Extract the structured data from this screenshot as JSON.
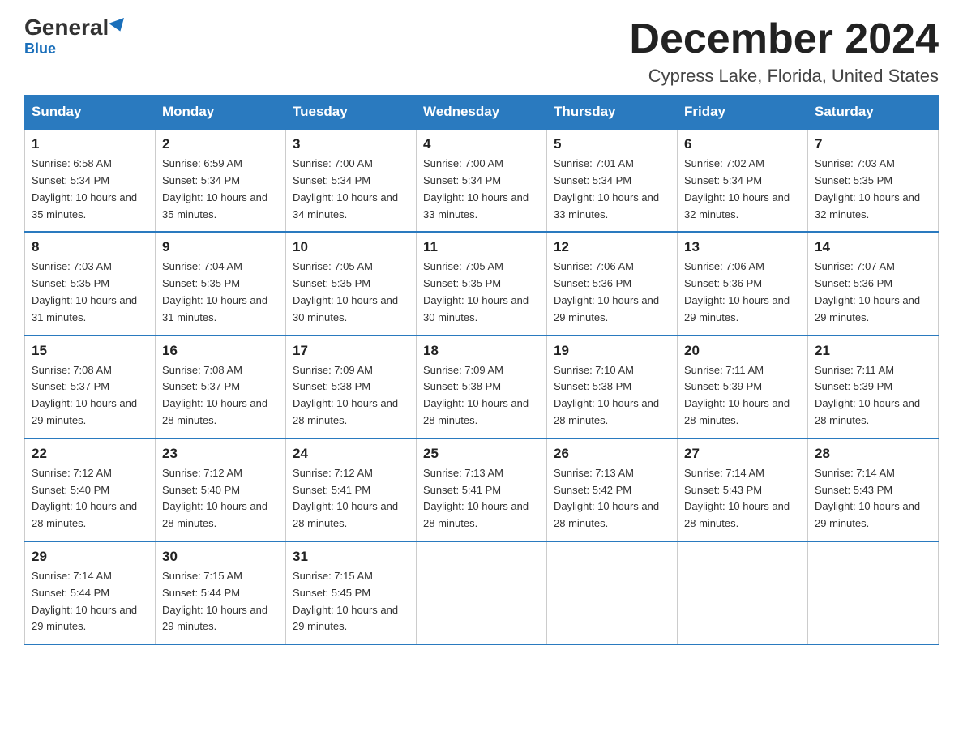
{
  "logo": {
    "name": "General",
    "name2": "Blue"
  },
  "header": {
    "month": "December 2024",
    "location": "Cypress Lake, Florida, United States"
  },
  "weekdays": [
    "Sunday",
    "Monday",
    "Tuesday",
    "Wednesday",
    "Thursday",
    "Friday",
    "Saturday"
  ],
  "weeks": [
    [
      {
        "day": "1",
        "sunrise": "6:58 AM",
        "sunset": "5:34 PM",
        "daylight": "10 hours and 35 minutes."
      },
      {
        "day": "2",
        "sunrise": "6:59 AM",
        "sunset": "5:34 PM",
        "daylight": "10 hours and 35 minutes."
      },
      {
        "day": "3",
        "sunrise": "7:00 AM",
        "sunset": "5:34 PM",
        "daylight": "10 hours and 34 minutes."
      },
      {
        "day": "4",
        "sunrise": "7:00 AM",
        "sunset": "5:34 PM",
        "daylight": "10 hours and 33 minutes."
      },
      {
        "day": "5",
        "sunrise": "7:01 AM",
        "sunset": "5:34 PM",
        "daylight": "10 hours and 33 minutes."
      },
      {
        "day": "6",
        "sunrise": "7:02 AM",
        "sunset": "5:34 PM",
        "daylight": "10 hours and 32 minutes."
      },
      {
        "day": "7",
        "sunrise": "7:03 AM",
        "sunset": "5:35 PM",
        "daylight": "10 hours and 32 minutes."
      }
    ],
    [
      {
        "day": "8",
        "sunrise": "7:03 AM",
        "sunset": "5:35 PM",
        "daylight": "10 hours and 31 minutes."
      },
      {
        "day": "9",
        "sunrise": "7:04 AM",
        "sunset": "5:35 PM",
        "daylight": "10 hours and 31 minutes."
      },
      {
        "day": "10",
        "sunrise": "7:05 AM",
        "sunset": "5:35 PM",
        "daylight": "10 hours and 30 minutes."
      },
      {
        "day": "11",
        "sunrise": "7:05 AM",
        "sunset": "5:35 PM",
        "daylight": "10 hours and 30 minutes."
      },
      {
        "day": "12",
        "sunrise": "7:06 AM",
        "sunset": "5:36 PM",
        "daylight": "10 hours and 29 minutes."
      },
      {
        "day": "13",
        "sunrise": "7:06 AM",
        "sunset": "5:36 PM",
        "daylight": "10 hours and 29 minutes."
      },
      {
        "day": "14",
        "sunrise": "7:07 AM",
        "sunset": "5:36 PM",
        "daylight": "10 hours and 29 minutes."
      }
    ],
    [
      {
        "day": "15",
        "sunrise": "7:08 AM",
        "sunset": "5:37 PM",
        "daylight": "10 hours and 29 minutes."
      },
      {
        "day": "16",
        "sunrise": "7:08 AM",
        "sunset": "5:37 PM",
        "daylight": "10 hours and 28 minutes."
      },
      {
        "day": "17",
        "sunrise": "7:09 AM",
        "sunset": "5:38 PM",
        "daylight": "10 hours and 28 minutes."
      },
      {
        "day": "18",
        "sunrise": "7:09 AM",
        "sunset": "5:38 PM",
        "daylight": "10 hours and 28 minutes."
      },
      {
        "day": "19",
        "sunrise": "7:10 AM",
        "sunset": "5:38 PM",
        "daylight": "10 hours and 28 minutes."
      },
      {
        "day": "20",
        "sunrise": "7:11 AM",
        "sunset": "5:39 PM",
        "daylight": "10 hours and 28 minutes."
      },
      {
        "day": "21",
        "sunrise": "7:11 AM",
        "sunset": "5:39 PM",
        "daylight": "10 hours and 28 minutes."
      }
    ],
    [
      {
        "day": "22",
        "sunrise": "7:12 AM",
        "sunset": "5:40 PM",
        "daylight": "10 hours and 28 minutes."
      },
      {
        "day": "23",
        "sunrise": "7:12 AM",
        "sunset": "5:40 PM",
        "daylight": "10 hours and 28 minutes."
      },
      {
        "day": "24",
        "sunrise": "7:12 AM",
        "sunset": "5:41 PM",
        "daylight": "10 hours and 28 minutes."
      },
      {
        "day": "25",
        "sunrise": "7:13 AM",
        "sunset": "5:41 PM",
        "daylight": "10 hours and 28 minutes."
      },
      {
        "day": "26",
        "sunrise": "7:13 AM",
        "sunset": "5:42 PM",
        "daylight": "10 hours and 28 minutes."
      },
      {
        "day": "27",
        "sunrise": "7:14 AM",
        "sunset": "5:43 PM",
        "daylight": "10 hours and 28 minutes."
      },
      {
        "day": "28",
        "sunrise": "7:14 AM",
        "sunset": "5:43 PM",
        "daylight": "10 hours and 29 minutes."
      }
    ],
    [
      {
        "day": "29",
        "sunrise": "7:14 AM",
        "sunset": "5:44 PM",
        "daylight": "10 hours and 29 minutes."
      },
      {
        "day": "30",
        "sunrise": "7:15 AM",
        "sunset": "5:44 PM",
        "daylight": "10 hours and 29 minutes."
      },
      {
        "day": "31",
        "sunrise": "7:15 AM",
        "sunset": "5:45 PM",
        "daylight": "10 hours and 29 minutes."
      },
      null,
      null,
      null,
      null
    ]
  ]
}
